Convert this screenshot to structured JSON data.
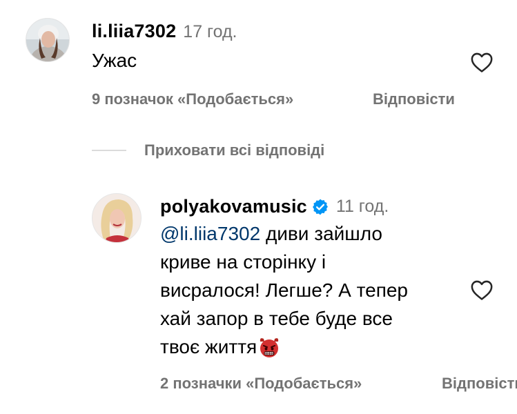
{
  "comment1": {
    "username": "li.liia7302",
    "time": "17 год.",
    "text": "Ужас",
    "likes": "9 позначок «Подобається»",
    "reply": "Відповісти"
  },
  "hide_replies": "Приховати всі відповіді",
  "reply1": {
    "username": "polyakovamusic",
    "time": "11 год.",
    "mention": "@li.liia7302",
    "line1": " диви зайшло",
    "line2": "криве на сторінку і",
    "line3": "висралося! Легше? А тепер",
    "line4": "хай запор в тебе буде все",
    "line5": "твоє життя",
    "emoji": "angry-devil-face",
    "likes": "2 позначки «Подобається»",
    "reply": "Відповісти"
  },
  "icons": {
    "like": "heart-outline-icon",
    "verified": "verified-badge-icon"
  },
  "colors": {
    "primary_text": "#000000",
    "secondary_text": "#737373",
    "mention": "#00376b",
    "verified": "#0095f6"
  }
}
